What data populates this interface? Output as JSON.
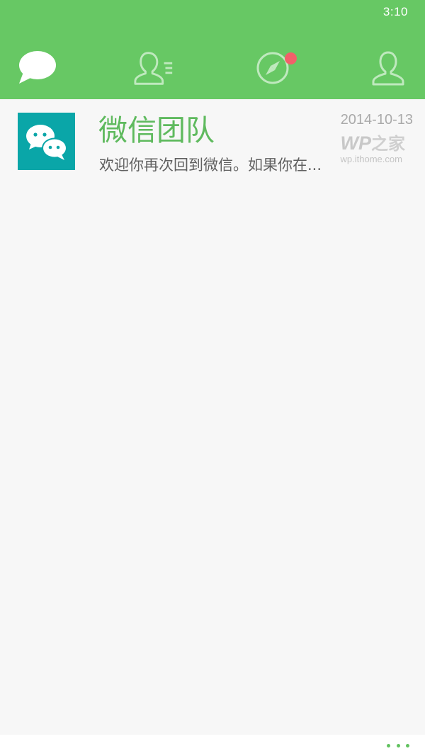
{
  "status_bar": {
    "time": "3:10"
  },
  "header": {
    "tabs": [
      {
        "name": "chats",
        "icon": "chat-bubble-icon",
        "active": true
      },
      {
        "name": "contacts",
        "icon": "contacts-list-icon",
        "active": false
      },
      {
        "name": "discover",
        "icon": "compass-icon",
        "active": false,
        "has_badge": true
      },
      {
        "name": "me",
        "icon": "person-icon",
        "active": false
      }
    ]
  },
  "chats": [
    {
      "name": "微信团队",
      "preview": "欢迎你再次回到微信。如果你在...",
      "date": "2014-10-13",
      "avatar_icon": "wechat-logo-icon"
    }
  ],
  "watermark": {
    "logo_latin": "WP",
    "logo_cn": "之家",
    "url": "wp.ithome.com"
  },
  "app_bar": {
    "more_icon": "ellipsis-icon"
  },
  "colors": {
    "header_bg": "#67c864",
    "accent_text": "#5fba5e",
    "badge": "#f2606a",
    "avatar_bg": "#0aa6a8",
    "list_bg": "#f7f7f7"
  }
}
